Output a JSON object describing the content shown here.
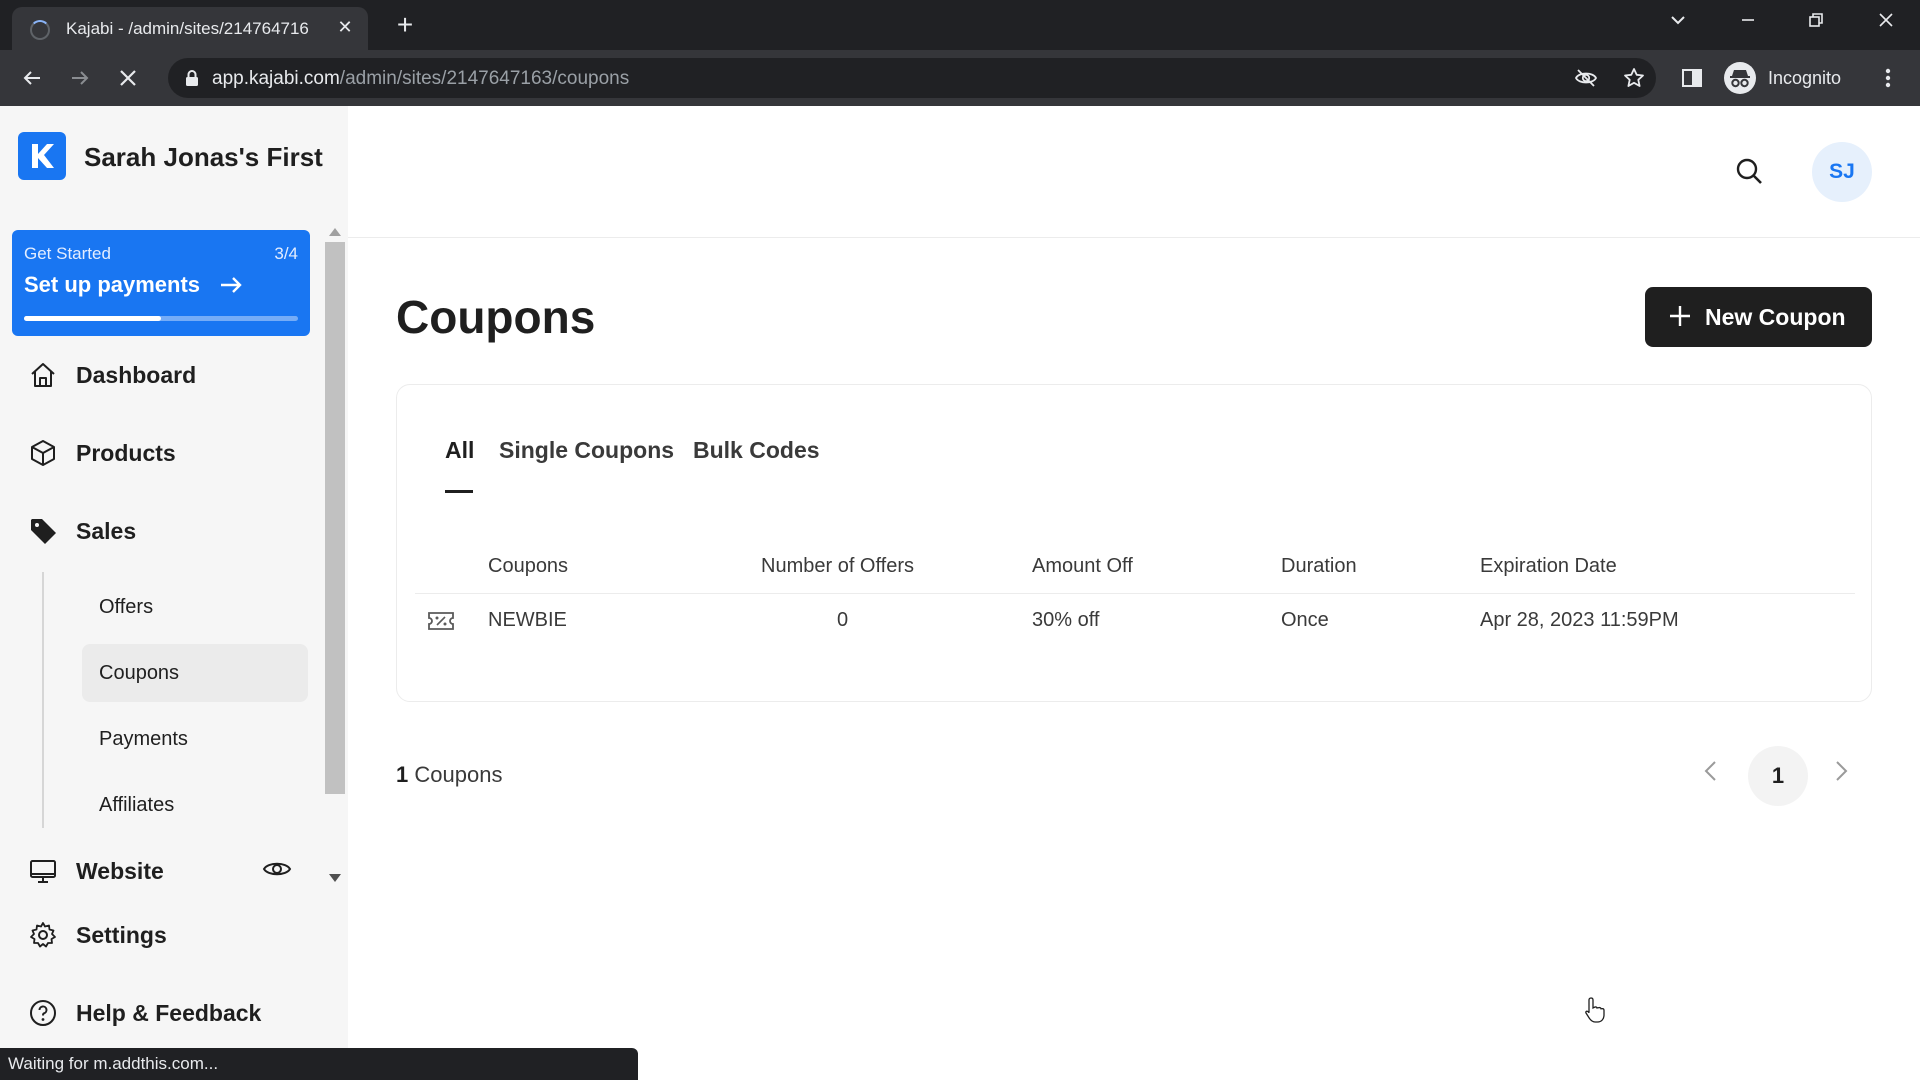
{
  "browser": {
    "tab_title": "Kajabi - /admin/sites/214764716",
    "url_host": "app.kajabi.com",
    "url_path": "/admin/sites/2147647163/coupons",
    "profile_label": "Incognito",
    "status_text": "Waiting for m.addthis.com..."
  },
  "sidebar": {
    "site_name": "Sarah Jonas's First",
    "get_started": {
      "label": "Get Started",
      "count": "3/4",
      "title": "Set up payments",
      "progress": 0.5
    },
    "nav": {
      "dashboard": "Dashboard",
      "products": "Products",
      "sales": "Sales",
      "website": "Website",
      "settings": "Settings",
      "help": "Help & Feedback"
    },
    "sales_sub": {
      "offers": "Offers",
      "coupons": "Coupons",
      "payments": "Payments",
      "affiliates": "Affiliates"
    }
  },
  "header": {
    "avatar_initials": "SJ"
  },
  "main": {
    "title": "Coupons",
    "new_button": "New Coupon",
    "tabs": {
      "all": "All",
      "single": "Single Coupons",
      "bulk": "Bulk Codes"
    },
    "columns": {
      "coupons": "Coupons",
      "offers": "Number of Offers",
      "amount": "Amount Off",
      "duration": "Duration",
      "expiration": "Expiration Date"
    },
    "rows": [
      {
        "code": "NEWBIE",
        "offers": "0",
        "amount": "30% off",
        "duration": "Once",
        "expiration": "Apr 28, 2023 11:59PM"
      }
    ],
    "count_number": "1",
    "count_label": "Coupons",
    "current_page": "1"
  },
  "colors": {
    "brand_blue": "#1976f2",
    "button_dark": "#1f1f1f"
  }
}
